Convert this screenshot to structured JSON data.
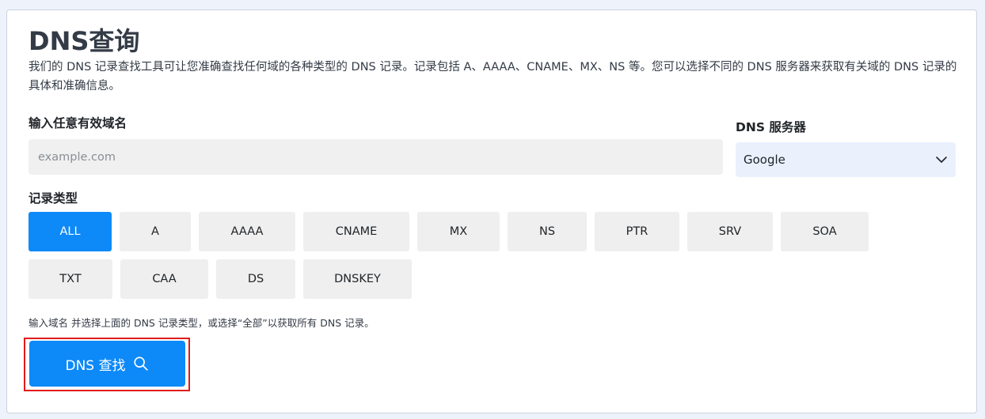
{
  "page": {
    "title": "DNS查询",
    "description": "我们的 DNS 记录查找工具可让您准确查找任何域的各种类型的 DNS 记录。记录包括 A、AAAA、CNAME、MX、NS 等。您可以选择不同的 DNS 服务器来获取有关域的 DNS 记录的具体和准确信息。"
  },
  "domain": {
    "label": "输入任意有效域名",
    "value": "",
    "placeholder": "example.com"
  },
  "server": {
    "label": "DNS 服务器",
    "selected": "Google"
  },
  "record_types": {
    "label": "记录类型",
    "items": [
      {
        "label": "ALL",
        "active": true
      },
      {
        "label": "A"
      },
      {
        "label": "AAAA"
      },
      {
        "label": "CNAME"
      },
      {
        "label": "MX"
      },
      {
        "label": "NS"
      },
      {
        "label": "PTR"
      },
      {
        "label": "SRV"
      },
      {
        "label": "SOA"
      },
      {
        "label": "TXT"
      },
      {
        "label": "CAA"
      },
      {
        "label": "DS"
      },
      {
        "label": "DNSKEY"
      }
    ]
  },
  "hint": "输入域名 并选择上面的 DNS 记录类型，或选择“全部”以获取所有 DNS 记录。",
  "lookup": {
    "label": "DNS 查找",
    "icon": "search-icon"
  },
  "colors": {
    "accent": "#0d89f8",
    "highlight": "#e11b1b"
  }
}
